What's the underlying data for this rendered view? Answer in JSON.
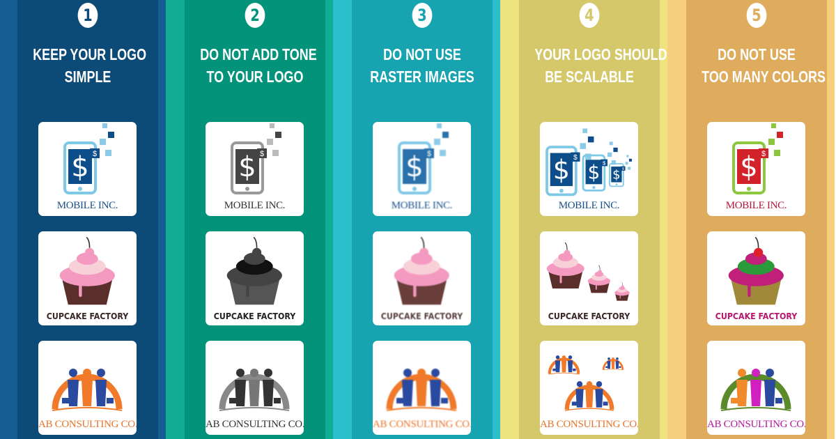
{
  "columns": [
    {
      "number": "1",
      "title": [
        "KEEP YOUR LOGO",
        "SIMPLE"
      ],
      "outer": "#145c92",
      "inner": "#0c4a78",
      "style": "simple",
      "cards": [
        {
          "brand": "MOBILE INC.",
          "text": "#1a4f8a"
        },
        {
          "brand": "CUPCAKE FACTORY",
          "text": "#3a2626"
        },
        {
          "brand": "AB CONSULTING CO.",
          "text": "#e8742a"
        }
      ]
    },
    {
      "number": "2",
      "title": [
        "DO NOT ADD TONE",
        "TO YOUR LOGO"
      ],
      "outer": "#10ad94",
      "inner": "#03937b",
      "style": "tone",
      "cards": [
        {
          "brand": "MOBILE INC.",
          "text": "#333333"
        },
        {
          "brand": "CUPCAKE FACTORY",
          "text": "#222222"
        },
        {
          "brand": "AB CONSULTING CO.",
          "text": "#333333"
        }
      ]
    },
    {
      "number": "3",
      "title": [
        "DO NOT USE",
        "RASTER IMAGES"
      ],
      "outer": "#2bbfcc",
      "inner": "#17a3b0",
      "style": "raster",
      "cards": [
        {
          "brand": "MOBILE INC.",
          "text": "#1a4f8a"
        },
        {
          "brand": "CUPCAKE FACTORY",
          "text": "#5a4040"
        },
        {
          "brand": "AB CONSULTING CO.",
          "text": "#e8742a"
        }
      ]
    },
    {
      "number": "4",
      "title": [
        "YOUR LOGO SHOULD",
        "BE SCALABLE"
      ],
      "outer": "#eee47f",
      "inner": "#d4c86a",
      "style": "scalable",
      "cards": [
        {
          "brand": "MOBILE INC.",
          "text": "#1a4f8a"
        },
        {
          "brand": "CUPCAKE FACTORY",
          "text": "#3a2626"
        },
        {
          "brand": "AB CONSULTING CO.",
          "text": "#e8742a"
        }
      ]
    },
    {
      "number": "5",
      "title": [
        "DO NOT USE",
        "TOO MANY COLORS"
      ],
      "outer": "#f7cf7d",
      "inner": "#dfab5c",
      "style": "colors",
      "cards": [
        {
          "brand": "MOBILE INC.",
          "text": "#b5163a"
        },
        {
          "brand": "CUPCAKE FACTORY",
          "text": "#b5166e"
        },
        {
          "brand": "AB CONSULTING CO.",
          "text": "#b5169e"
        }
      ]
    }
  ],
  "icons": [
    "phone-dollar-icon",
    "cupcake-icon",
    "business-people-arc-icon"
  ]
}
